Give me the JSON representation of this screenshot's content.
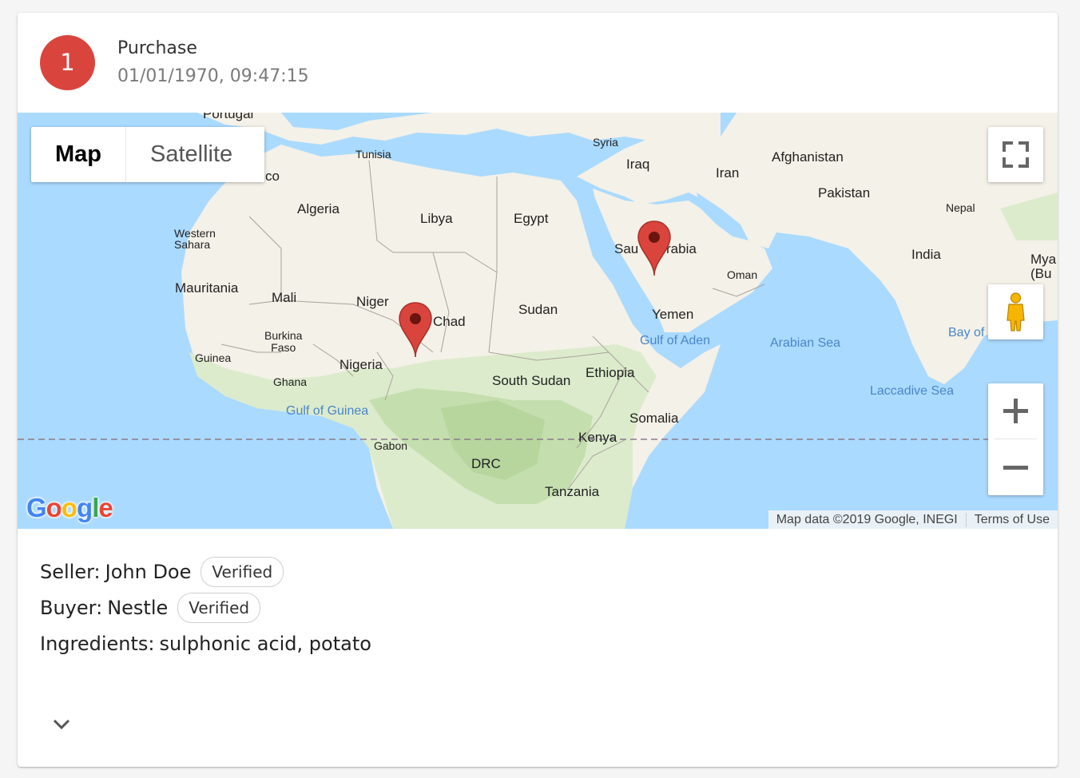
{
  "header": {
    "step_number": "1",
    "title": "Purchase",
    "timestamp": "01/01/1970, 09:47:15"
  },
  "map": {
    "map_type": {
      "options": [
        "Map",
        "Satellite"
      ],
      "selected": "Map"
    },
    "labels": {
      "portugal": "Portugal",
      "morocco": "co",
      "tunisia": "Tunisia",
      "syria": "Syria",
      "iraq": "Iraq",
      "iran": "Iran",
      "afghanistan": "Afghanistan",
      "pakistan": "Pakistan",
      "nepal": "Nepal",
      "algeria": "Algeria",
      "libya": "Libya",
      "egypt": "Egypt",
      "western_sahara": "Western\nSahara",
      "saudi_arabia_left": "Sau",
      "saudi_arabia_right": "rabia",
      "oman": "Oman",
      "india": "India",
      "myanmar": "Mya\n(Bu",
      "mauritania": "Mauritania",
      "mali": "Mali",
      "niger": "Niger",
      "chad": "Chad",
      "sudan": "Sudan",
      "yemen": "Yemen",
      "burkina_faso": "Burkina\nFaso",
      "guinea": "Guinea",
      "ghana": "Ghana",
      "nigeria": "Nigeria",
      "south_sudan": "South Sudan",
      "ethiopia": "Ethiopia",
      "somalia": "Somalia",
      "kenya": "Kenya",
      "gabon": "Gabon",
      "drc": "DRC",
      "tanzania": "Tanzania",
      "gulf_of_aden": "Gulf of Aden",
      "arabian_sea": "Arabian Sea",
      "bay_of": "Bay of",
      "laccadive_sea": "Laccadive Sea",
      "gulf_of_guinea": "Gulf of Guinea"
    },
    "google_logo": "Google",
    "attribution": "Map data ©2019 Google, INEGI",
    "terms": "Terms of Use",
    "marker_color": "#d9453d",
    "colors": {
      "water": "#aadaff",
      "land": "#f4f1e8",
      "forest": "#cfe5bf"
    }
  },
  "details": {
    "seller_label": "Seller:",
    "seller_name": "John Doe",
    "seller_badge": "Verified",
    "buyer_label": "Buyer:",
    "buyer_name": "Nestle",
    "buyer_badge": "Verified",
    "ingredients_label": "Ingredients:",
    "ingredients_value": "sulphonic acid, potato"
  }
}
